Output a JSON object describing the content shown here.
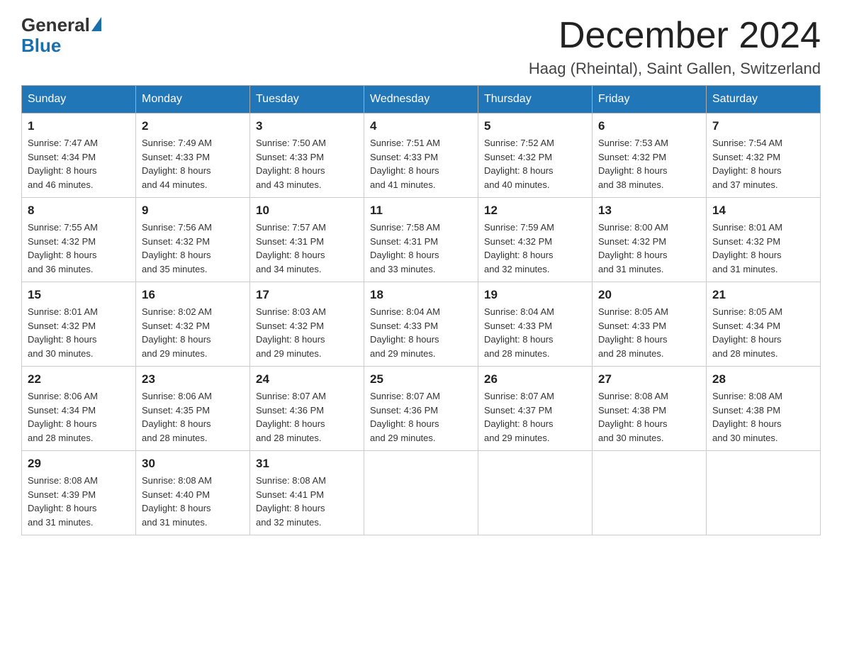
{
  "logo": {
    "general_text": "General",
    "blue_text": "Blue"
  },
  "header": {
    "month_year": "December 2024",
    "location": "Haag (Rheintal), Saint Gallen, Switzerland"
  },
  "weekdays": [
    "Sunday",
    "Monday",
    "Tuesday",
    "Wednesday",
    "Thursday",
    "Friday",
    "Saturday"
  ],
  "weeks": [
    [
      {
        "day": "1",
        "sunrise": "7:47 AM",
        "sunset": "4:34 PM",
        "daylight": "8 hours and 46 minutes."
      },
      {
        "day": "2",
        "sunrise": "7:49 AM",
        "sunset": "4:33 PM",
        "daylight": "8 hours and 44 minutes."
      },
      {
        "day": "3",
        "sunrise": "7:50 AM",
        "sunset": "4:33 PM",
        "daylight": "8 hours and 43 minutes."
      },
      {
        "day": "4",
        "sunrise": "7:51 AM",
        "sunset": "4:33 PM",
        "daylight": "8 hours and 41 minutes."
      },
      {
        "day": "5",
        "sunrise": "7:52 AM",
        "sunset": "4:32 PM",
        "daylight": "8 hours and 40 minutes."
      },
      {
        "day": "6",
        "sunrise": "7:53 AM",
        "sunset": "4:32 PM",
        "daylight": "8 hours and 38 minutes."
      },
      {
        "day": "7",
        "sunrise": "7:54 AM",
        "sunset": "4:32 PM",
        "daylight": "8 hours and 37 minutes."
      }
    ],
    [
      {
        "day": "8",
        "sunrise": "7:55 AM",
        "sunset": "4:32 PM",
        "daylight": "8 hours and 36 minutes."
      },
      {
        "day": "9",
        "sunrise": "7:56 AM",
        "sunset": "4:32 PM",
        "daylight": "8 hours and 35 minutes."
      },
      {
        "day": "10",
        "sunrise": "7:57 AM",
        "sunset": "4:31 PM",
        "daylight": "8 hours and 34 minutes."
      },
      {
        "day": "11",
        "sunrise": "7:58 AM",
        "sunset": "4:31 PM",
        "daylight": "8 hours and 33 minutes."
      },
      {
        "day": "12",
        "sunrise": "7:59 AM",
        "sunset": "4:32 PM",
        "daylight": "8 hours and 32 minutes."
      },
      {
        "day": "13",
        "sunrise": "8:00 AM",
        "sunset": "4:32 PM",
        "daylight": "8 hours and 31 minutes."
      },
      {
        "day": "14",
        "sunrise": "8:01 AM",
        "sunset": "4:32 PM",
        "daylight": "8 hours and 31 minutes."
      }
    ],
    [
      {
        "day": "15",
        "sunrise": "8:01 AM",
        "sunset": "4:32 PM",
        "daylight": "8 hours and 30 minutes."
      },
      {
        "day": "16",
        "sunrise": "8:02 AM",
        "sunset": "4:32 PM",
        "daylight": "8 hours and 29 minutes."
      },
      {
        "day": "17",
        "sunrise": "8:03 AM",
        "sunset": "4:32 PM",
        "daylight": "8 hours and 29 minutes."
      },
      {
        "day": "18",
        "sunrise": "8:04 AM",
        "sunset": "4:33 PM",
        "daylight": "8 hours and 29 minutes."
      },
      {
        "day": "19",
        "sunrise": "8:04 AM",
        "sunset": "4:33 PM",
        "daylight": "8 hours and 28 minutes."
      },
      {
        "day": "20",
        "sunrise": "8:05 AM",
        "sunset": "4:33 PM",
        "daylight": "8 hours and 28 minutes."
      },
      {
        "day": "21",
        "sunrise": "8:05 AM",
        "sunset": "4:34 PM",
        "daylight": "8 hours and 28 minutes."
      }
    ],
    [
      {
        "day": "22",
        "sunrise": "8:06 AM",
        "sunset": "4:34 PM",
        "daylight": "8 hours and 28 minutes."
      },
      {
        "day": "23",
        "sunrise": "8:06 AM",
        "sunset": "4:35 PM",
        "daylight": "8 hours and 28 minutes."
      },
      {
        "day": "24",
        "sunrise": "8:07 AM",
        "sunset": "4:36 PM",
        "daylight": "8 hours and 28 minutes."
      },
      {
        "day": "25",
        "sunrise": "8:07 AM",
        "sunset": "4:36 PM",
        "daylight": "8 hours and 29 minutes."
      },
      {
        "day": "26",
        "sunrise": "8:07 AM",
        "sunset": "4:37 PM",
        "daylight": "8 hours and 29 minutes."
      },
      {
        "day": "27",
        "sunrise": "8:08 AM",
        "sunset": "4:38 PM",
        "daylight": "8 hours and 30 minutes."
      },
      {
        "day": "28",
        "sunrise": "8:08 AM",
        "sunset": "4:38 PM",
        "daylight": "8 hours and 30 minutes."
      }
    ],
    [
      {
        "day": "29",
        "sunrise": "8:08 AM",
        "sunset": "4:39 PM",
        "daylight": "8 hours and 31 minutes."
      },
      {
        "day": "30",
        "sunrise": "8:08 AM",
        "sunset": "4:40 PM",
        "daylight": "8 hours and 31 minutes."
      },
      {
        "day": "31",
        "sunrise": "8:08 AM",
        "sunset": "4:41 PM",
        "daylight": "8 hours and 32 minutes."
      },
      null,
      null,
      null,
      null
    ]
  ],
  "labels": {
    "sunrise": "Sunrise:",
    "sunset": "Sunset:",
    "daylight": "Daylight:"
  }
}
